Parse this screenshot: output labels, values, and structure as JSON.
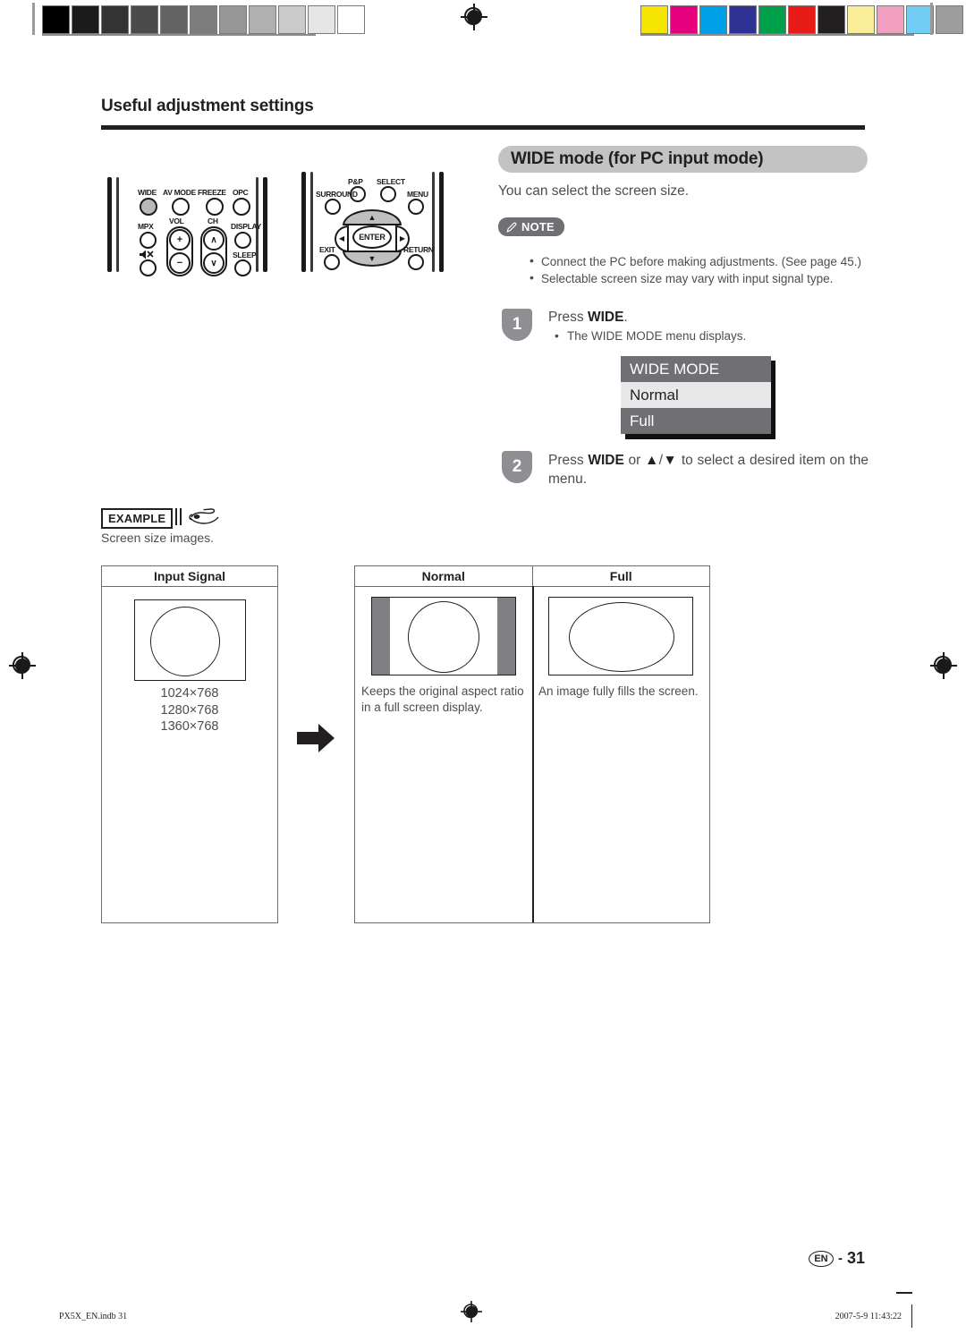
{
  "document": {
    "section_title": "Useful adjustment settings",
    "page_label": "EN",
    "page_number": "31",
    "print_file": "PX5X_EN.indb   31",
    "print_timestamp": "2007-5-9   11:43:22"
  },
  "calibration": {
    "gray_patches": [
      "#000000",
      "#1b1b1b",
      "#333333",
      "#4b4b4b",
      "#636363",
      "#7d7d7d",
      "#969696",
      "#b0b0b0",
      "#cacaca",
      "#e6e6e6",
      "#ffffff"
    ],
    "color_patches": [
      "#f5e400",
      "#e5007e",
      "#00a0e9",
      "#2e3192",
      "#00a04a",
      "#e71b17",
      "#231f20",
      "#faee9a",
      "#f2a0c0",
      "#72cdf4",
      "#9d9d9d"
    ]
  },
  "remote_left": {
    "top_row": [
      {
        "label": "WIDE",
        "highlighted": true
      },
      {
        "label": "AV MODE",
        "highlighted": false
      },
      {
        "label": "FREEZE",
        "highlighted": false
      },
      {
        "label": "OPC",
        "highlighted": false
      }
    ],
    "mpx_label": "MPX",
    "mute_label": "mute-icon",
    "vol_label": "VOL",
    "vol_plus": "+",
    "vol_minus": "−",
    "ch_label": "CH",
    "ch_up": "∧",
    "ch_down": "∨",
    "display_label": "DISPLAY",
    "sleep_label": "SLEEP"
  },
  "remote_right": {
    "pp_label": "P&P",
    "select_label": "SELECT",
    "surround_label": "SURROUND",
    "menu_label": "MENU",
    "enter_label": "ENTER",
    "exit_label": "EXIT",
    "return_label": "RETURN",
    "up_arrow": "▲",
    "down_arrow": "▼",
    "left_arrow": "◀",
    "right_arrow": "▶"
  },
  "main": {
    "title": "WIDE mode (for PC input mode)",
    "intro": "You can select the screen size.",
    "note_label": "NOTE",
    "notes": [
      "Connect the PC before making adjustments. (See page 45.)",
      "Selectable screen size may vary with input signal type."
    ],
    "steps": [
      {
        "number": "1",
        "text_prefix": "Press ",
        "text_bold": "WIDE",
        "text_suffix": ".",
        "sub": "The WIDE MODE menu displays."
      },
      {
        "number": "2",
        "full_text": "Press WIDE or ▲/▼ to select a desired item on the menu."
      }
    ],
    "osd_menu": {
      "title": "WIDE MODE",
      "items": [
        {
          "label": "Normal",
          "selected": true
        },
        {
          "label": "Full",
          "selected": false
        }
      ]
    }
  },
  "example": {
    "badge": "EXAMPLE",
    "caption": "Screen size images.",
    "input_column": {
      "header": "Input Signal",
      "resolutions": [
        "1024×768",
        "1280×768",
        "1360×768"
      ]
    },
    "result_columns": [
      {
        "header": "Normal",
        "description": "Keeps the original aspect ratio in a full screen display.",
        "has_side_bars": true
      },
      {
        "header": "Full",
        "description": "An image fully fills the screen.",
        "has_side_bars": false
      }
    ]
  },
  "colors": {
    "title_pill": "#c3c3c3",
    "note_pill": "#6f6f74",
    "step_badge": "#8e8e93",
    "osd_bg": "#6f6f74",
    "osd_selected": "#e8e8e8",
    "side_bar_gray": "#808083",
    "body_text": "#4d4d4d"
  }
}
